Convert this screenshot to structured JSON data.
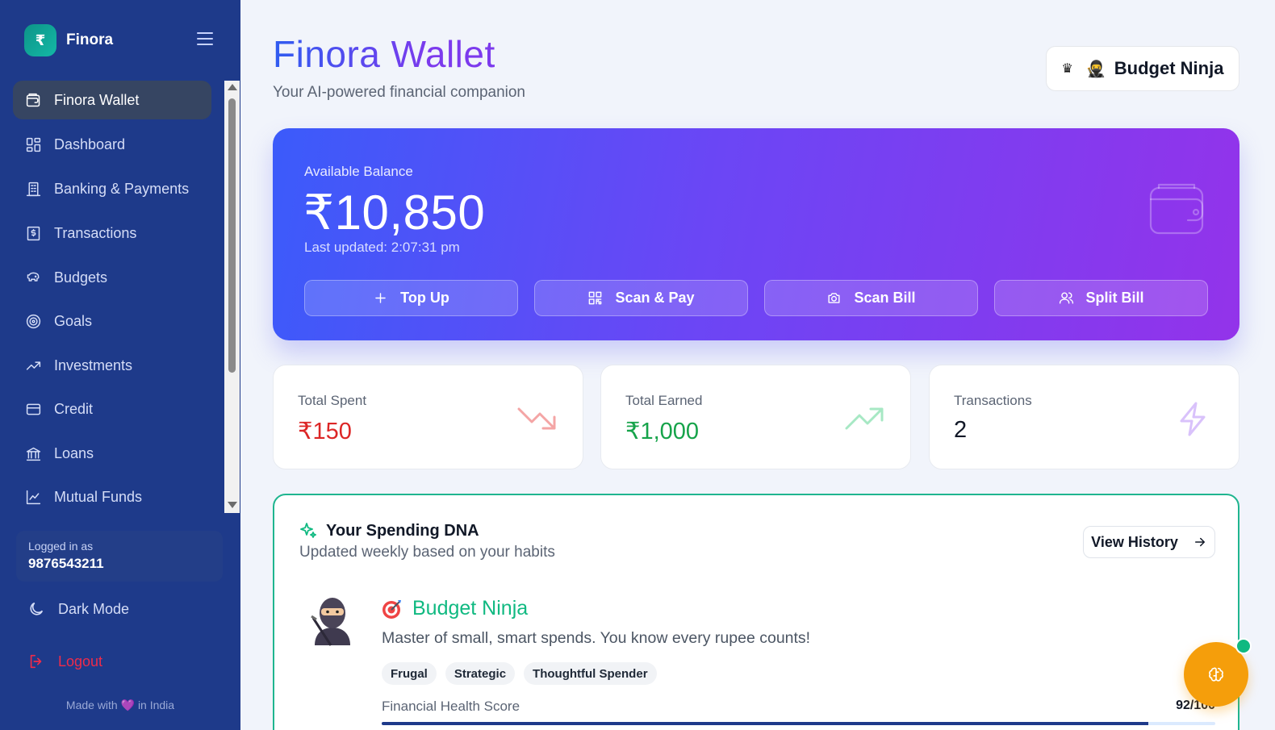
{
  "sidebar": {
    "brand_symbol": "₹",
    "brand_name": "Finora",
    "items": [
      {
        "label": "Finora Wallet",
        "icon": "wallet-icon",
        "active": true
      },
      {
        "label": "Dashboard",
        "icon": "dashboard-icon"
      },
      {
        "label": "Banking & Payments",
        "icon": "building-icon"
      },
      {
        "label": "Transactions",
        "icon": "receipt-icon"
      },
      {
        "label": "Budgets",
        "icon": "piggy-bank-icon"
      },
      {
        "label": "Goals",
        "icon": "target-icon"
      },
      {
        "label": "Investments",
        "icon": "trending-up-icon"
      },
      {
        "label": "Credit",
        "icon": "credit-card-icon"
      },
      {
        "label": "Loans",
        "icon": "bank-icon"
      },
      {
        "label": "Mutual Funds",
        "icon": "line-chart-icon"
      }
    ],
    "logged_in_label": "Logged in as",
    "phone": "9876543211",
    "dark_mode_label": "Dark Mode",
    "logout_label": "Logout",
    "made_with_prefix": "Made with",
    "made_with_heart": "💜",
    "made_with_suffix": "in India"
  },
  "header": {
    "title": "Finora Wallet",
    "subtitle": "Your AI-powered financial companion",
    "badge_crown": "♛",
    "badge_emoji": "🥷",
    "badge_label": "Budget Ninja"
  },
  "balance": {
    "label": "Available Balance",
    "amount": "₹10,850",
    "updated": "Last updated: 2:07:31 pm",
    "actions": [
      "Top Up",
      "Scan & Pay",
      "Scan Bill",
      "Split Bill"
    ]
  },
  "stats": [
    {
      "label": "Total Spent",
      "value": "₹150",
      "color": "#dc2626",
      "icon": "trending-down-icon",
      "icon_color": "#f4a5a5"
    },
    {
      "label": "Total Earned",
      "value": "₹1,000",
      "color": "#16a34a",
      "icon": "trending-up-icon",
      "icon_color": "#a7e8c4"
    },
    {
      "label": "Transactions",
      "value": "2",
      "color": "#111827",
      "icon": "lightning-icon",
      "icon_color": "#d9c2fb"
    }
  ],
  "dna": {
    "title": "Your Spending DNA",
    "subtitle": "Updated weekly based on your habits",
    "view_history": "View History",
    "persona_name": "Budget Ninja",
    "persona_desc": "Master of small, smart spends. You know every rupee counts!",
    "tags": [
      "Frugal",
      "Strategic",
      "Thoughtful Spender"
    ],
    "health_label": "Financial Health Score",
    "health_value": "92/100",
    "health_fraction": 0.92
  },
  "colors": {
    "sidebar_bg": "#1e3a8a",
    "accent_gradient_start": "#3b5bfa",
    "accent_gradient_end": "#9333ea",
    "dna_border": "#1fb58f",
    "fab": "#f59e0b"
  }
}
